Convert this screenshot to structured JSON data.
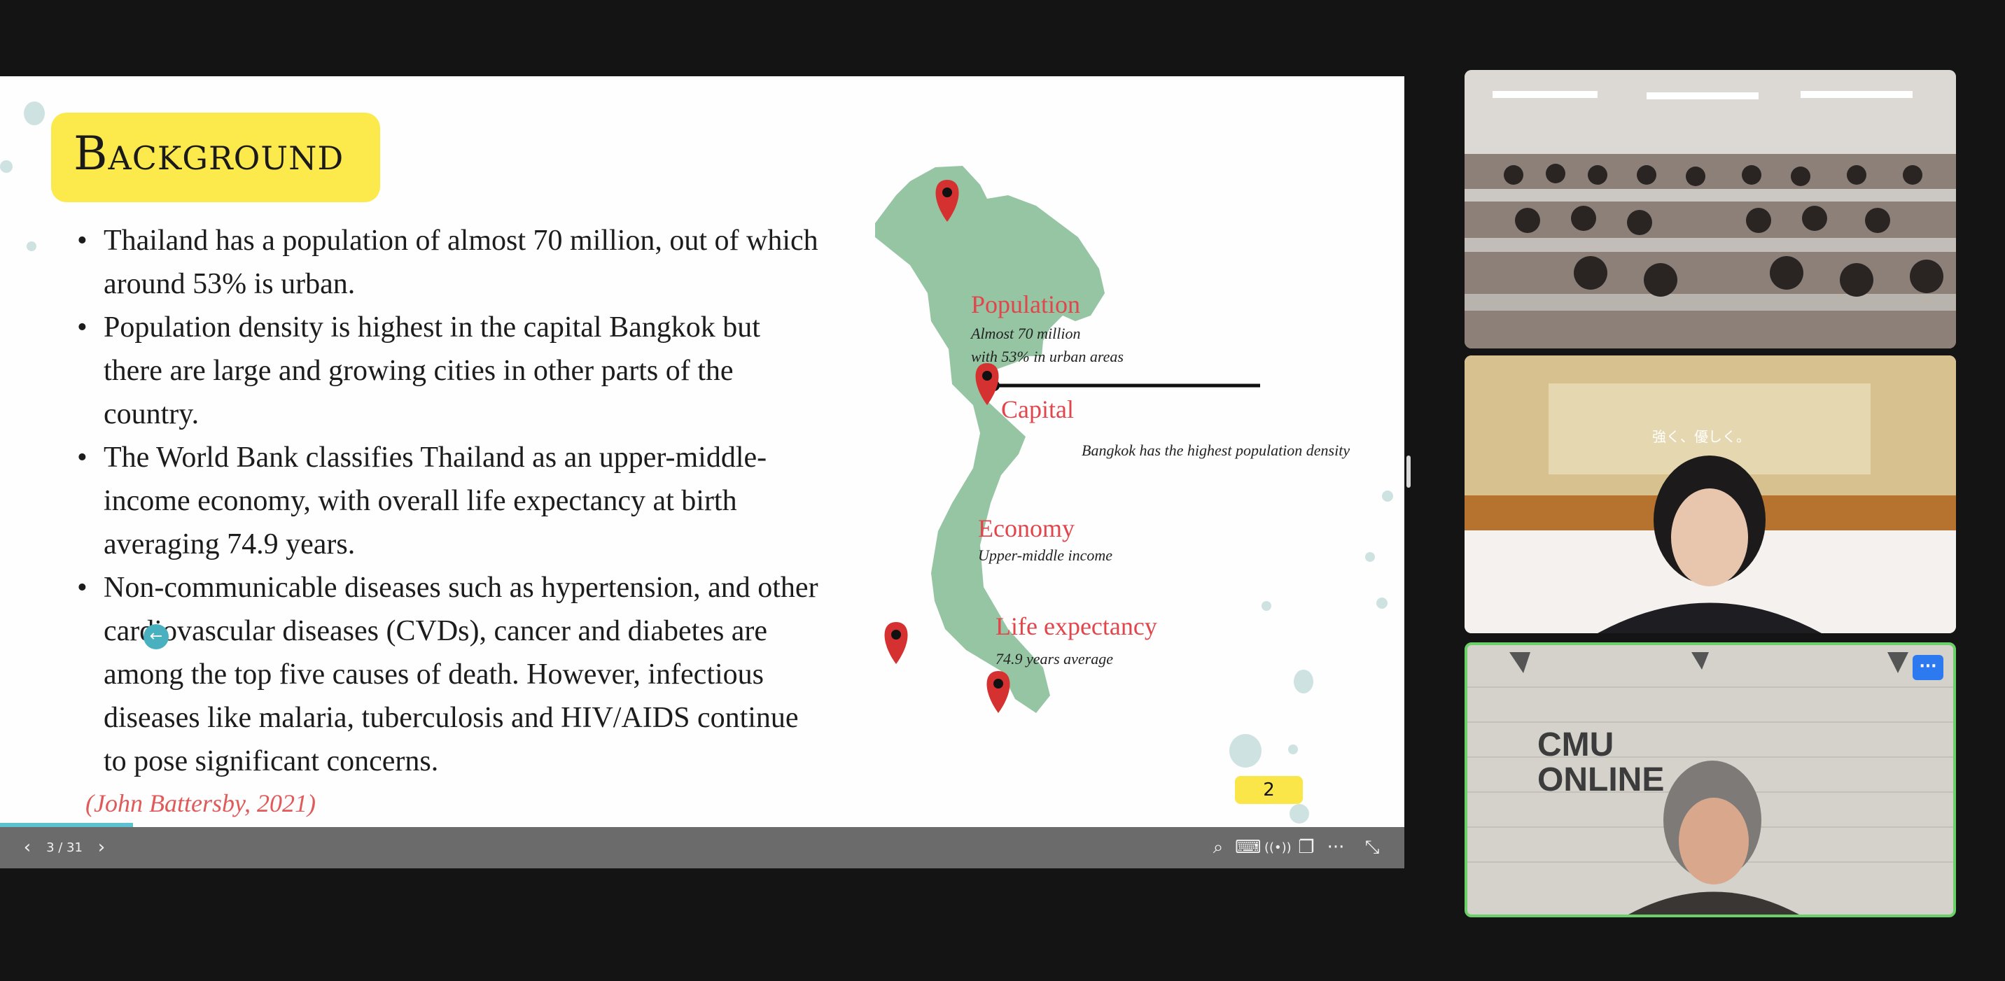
{
  "slide": {
    "title": "Background",
    "bullets": [
      "Thailand has a population of almost 70 million, out of which around 53% is urban.",
      "Population density is highest in the capital Bangkok but there are large and growing cities in other parts of the country.",
      "The World Bank classifies Thailand as an upper-middle-income economy, with overall life expectancy at birth averaging 74.9 years.",
      "Non-communicable diseases such as hypertension, and other cardiovascular diseases (CVDs), cancer and diabetes are among the top five causes of death. However, infectious diseases like malaria, tuberculosis and HIV/AIDS continue to pose significant concerns."
    ],
    "citation": "(John Battersby, 2021)",
    "page_number": "2",
    "cursor_icon": "arrow-left-icon",
    "map": {
      "population_label": "Population",
      "population_sub1": "Almost 70 million",
      "population_sub2": "with 53% in urban areas",
      "capital_label": "Capital",
      "capital_note": "Bangkok has the highest population density",
      "economy_label": "Economy",
      "economy_sub": "Upper-middle income",
      "life_label": "Life expectancy",
      "life_sub": "74.9 years average",
      "land_color": "#95c5a2",
      "pin_color": "#d63131"
    }
  },
  "toolbar": {
    "prev_icon": "‹",
    "slide_counter": "3 / 31",
    "next_icon": "›",
    "zoom_icon": "⌕",
    "keyboard_icon": "⌨",
    "broadcast_icon": "((•))",
    "window_icon": "❐",
    "more_icon": "···",
    "collapse_icon": "⤡"
  },
  "participants": {
    "tile3_caption_line1": "CMU",
    "tile3_caption_line2": "ONLINE",
    "tile2_banner": "強く、優しく。",
    "more_button": "···"
  },
  "colors": {
    "accent_yellow": "#fce94b",
    "active_speaker": "#6bd067",
    "button_blue": "#2d7af0"
  }
}
